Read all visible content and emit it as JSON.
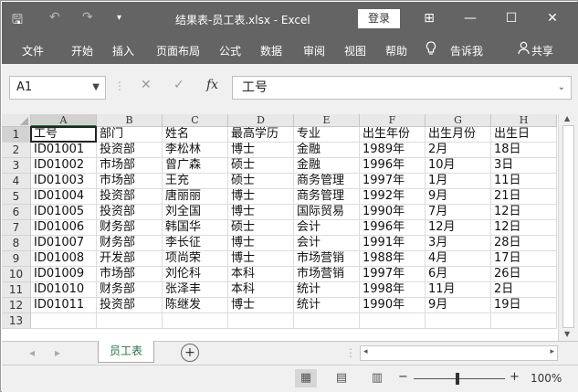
{
  "window": {
    "title": "结果表-员工表.xlsx - Excel",
    "login_label": "登录",
    "quick_access": [
      "🖫",
      "↶",
      "↷",
      "▾"
    ],
    "win_controls": [
      "⊞",
      "—",
      "☐",
      "✕"
    ]
  },
  "ribbon": {
    "tabs": [
      "文件",
      "开始",
      "插入",
      "页面布局",
      "公式",
      "数据",
      "审阅",
      "视图",
      "帮助",
      "告诉我"
    ],
    "tell_icon": "lightbulb-icon",
    "share_label": "共享"
  },
  "formula_bar": {
    "name_box": "A1",
    "cancel_symbol": "✕",
    "enter_symbol": "✓",
    "fx_symbol": "fx",
    "content": "工号"
  },
  "sheet": {
    "columns": [
      "A",
      "B",
      "C",
      "D",
      "E",
      "F",
      "G",
      "H"
    ],
    "rows": [
      {
        "num": "1",
        "cells": [
          "工号",
          "部门",
          "姓名",
          "最高学历",
          "专业",
          "出生年份",
          "出生月份",
          "出生日"
        ]
      },
      {
        "num": "2",
        "cells": [
          "ID01001",
          "投资部",
          "李松林",
          "博士",
          "金融",
          "1989年",
          "2月",
          "18日"
        ]
      },
      {
        "num": "3",
        "cells": [
          "ID01002",
          "市场部",
          "曾广森",
          "硕士",
          "金融",
          "1996年",
          "10月",
          "3日"
        ]
      },
      {
        "num": "4",
        "cells": [
          "ID01003",
          "市场部",
          "王充",
          "硕士",
          "商务管理",
          "1997年",
          "1月",
          "11日"
        ]
      },
      {
        "num": "5",
        "cells": [
          "ID01004",
          "投资部",
          "唐丽丽",
          "博士",
          "商务管理",
          "1992年",
          "9月",
          "21日"
        ]
      },
      {
        "num": "6",
        "cells": [
          "ID01005",
          "投资部",
          "刘全国",
          "博士",
          "国际贸易",
          "1990年",
          "7月",
          "12日"
        ]
      },
      {
        "num": "7",
        "cells": [
          "ID01006",
          "财务部",
          "韩国华",
          "硕士",
          "会计",
          "1996年",
          "12月",
          "12日"
        ]
      },
      {
        "num": "8",
        "cells": [
          "ID01007",
          "财务部",
          "李长征",
          "博士",
          "会计",
          "1991年",
          "3月",
          "28日"
        ]
      },
      {
        "num": "9",
        "cells": [
          "ID01008",
          "开发部",
          "项尚荣",
          "博士",
          "市场营销",
          "1988年",
          "4月",
          "17日"
        ]
      },
      {
        "num": "10",
        "cells": [
          "ID01009",
          "市场部",
          "刘伦科",
          "本科",
          "市场营销",
          "1997年",
          "6月",
          "26日"
        ]
      },
      {
        "num": "11",
        "cells": [
          "ID01010",
          "财务部",
          "张泽丰",
          "本科",
          "统计",
          "1998年",
          "11月",
          "2日"
        ]
      },
      {
        "num": "12",
        "cells": [
          "ID01011",
          "投资部",
          "陈继发",
          "博士",
          "统计",
          "1990年",
          "9月",
          "19日"
        ]
      },
      {
        "num": "13",
        "cells": [
          "",
          "",
          "",
          "",
          "",
          "",
          "",
          ""
        ]
      }
    ]
  },
  "tabs": {
    "sheet_name": "员工表",
    "add_symbol": "+"
  },
  "status": {
    "zoom": "100%",
    "zoom_out": "−",
    "zoom_in": "+"
  }
}
